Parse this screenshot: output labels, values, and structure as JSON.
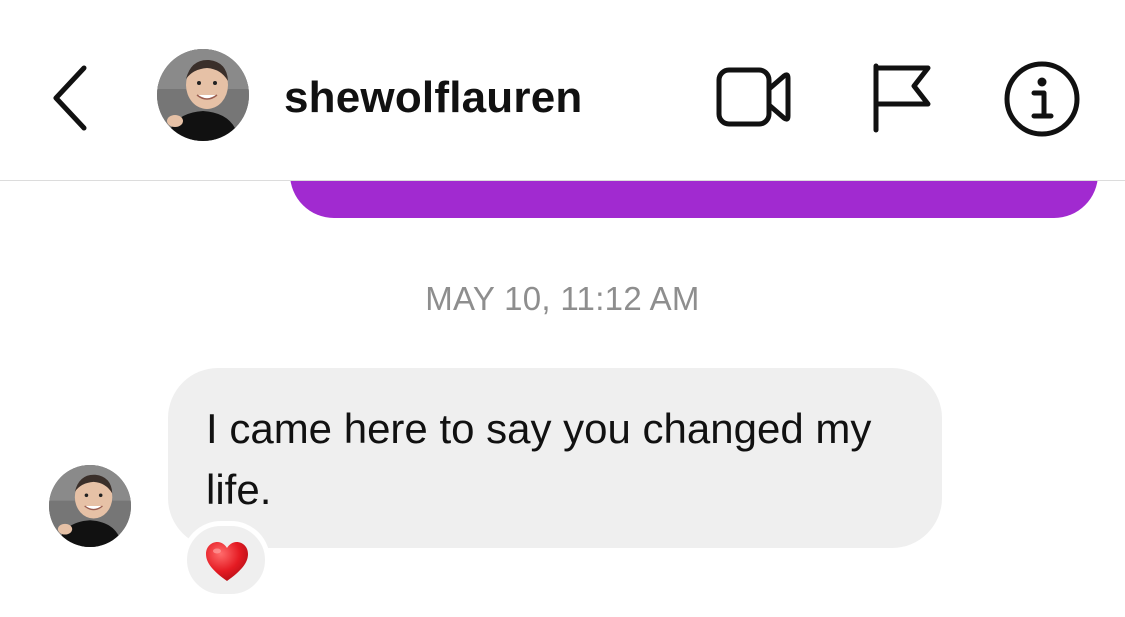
{
  "header": {
    "username": "shewolflauren",
    "back_icon": "chevron-left-icon",
    "avatar_icon": "profile-photo",
    "actions": [
      {
        "name": "video-call",
        "icon": "video-camera-icon"
      },
      {
        "name": "report",
        "icon": "flag-icon"
      },
      {
        "name": "details",
        "icon": "info-icon"
      }
    ]
  },
  "thread": {
    "sent_bubble_color": "#a12ad0",
    "timestamp": "MAY 10, 11:12 AM",
    "received_message": {
      "text": "I came here to say you changed my life.",
      "reaction": "❤️",
      "reaction_icon": "heart-icon",
      "bubble_color": "#efefef"
    }
  }
}
